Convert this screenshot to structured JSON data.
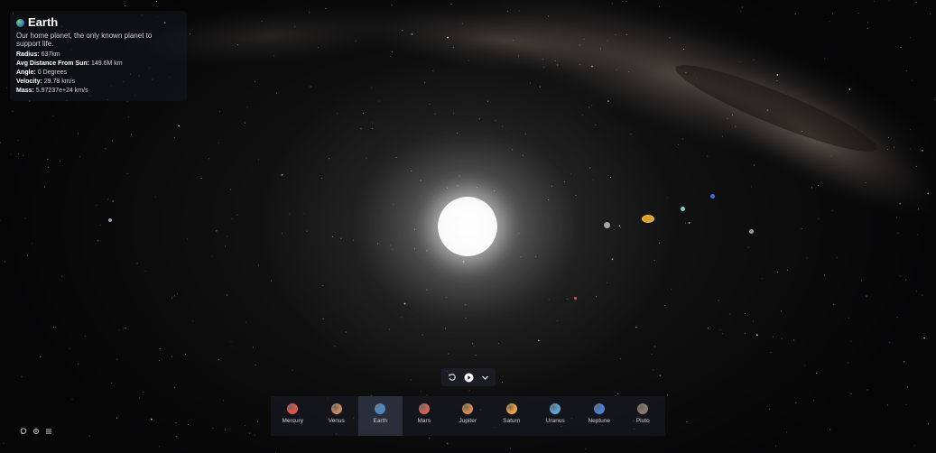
{
  "info": {
    "title": "Earth",
    "description": "Our home planet, the only known planet to support life.",
    "stats": [
      {
        "label": "Radius:",
        "value": "637km"
      },
      {
        "label": "Avg Distance From Sun:",
        "value": "149.6M km"
      },
      {
        "label": "Angle:",
        "value": "0 Degrees"
      },
      {
        "label": "Velocity:",
        "value": "29.78 km/s"
      },
      {
        "label": "Mass:",
        "value": "5.97237e+24 km/s"
      }
    ]
  },
  "controls": {
    "reset_icon": "reset-icon",
    "play_icon": "play-icon",
    "expand_icon": "chevron-down-icon"
  },
  "planets": [
    {
      "name": "Mercury",
      "color": "#e8553e",
      "active": false
    },
    {
      "name": "Venus",
      "color": "#c98a5a",
      "active": false
    },
    {
      "name": "Earth",
      "color": "#3f8fd0",
      "active": true
    },
    {
      "name": "Mars",
      "color": "#d9644a",
      "active": false
    },
    {
      "name": "Jupiter",
      "color": "#d98b4a",
      "active": false
    },
    {
      "name": "Saturn",
      "color": "#f0a53a",
      "active": false
    },
    {
      "name": "Uranus",
      "color": "#5aa6d8",
      "active": false
    },
    {
      "name": "Neptune",
      "color": "#4b7fe0",
      "active": false
    },
    {
      "name": "Pluto",
      "color": "#8a7a6a",
      "active": false
    }
  ],
  "bottom_left_icons": [
    "chat-icon",
    "settings-icon",
    "menu-icon"
  ]
}
